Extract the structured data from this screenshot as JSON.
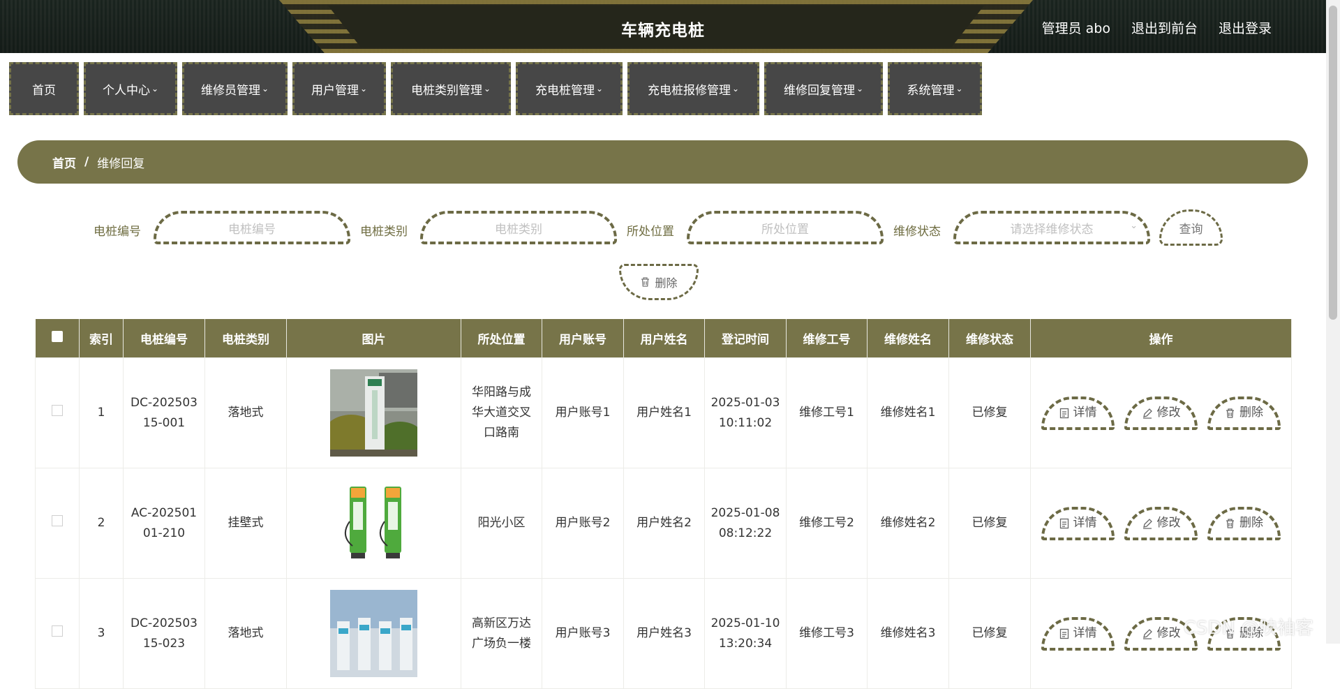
{
  "header": {
    "title": "车辆充电桩",
    "user_label": "管理员 abo",
    "to_front": "退出到前台",
    "logout": "退出登录"
  },
  "nav": [
    {
      "label": "首页",
      "has_dropdown": false
    },
    {
      "label": "个人中心",
      "has_dropdown": true
    },
    {
      "label": "维修员管理",
      "has_dropdown": true
    },
    {
      "label": "用户管理",
      "has_dropdown": true
    },
    {
      "label": "电桩类别管理",
      "has_dropdown": true
    },
    {
      "label": "充电桩管理",
      "has_dropdown": true
    },
    {
      "label": "充电桩报修管理",
      "has_dropdown": true
    },
    {
      "label": "维修回复管理",
      "has_dropdown": true
    },
    {
      "label": "系统管理",
      "has_dropdown": true
    }
  ],
  "breadcrumb": {
    "home": "首页",
    "separator": "/",
    "current": "维修回复"
  },
  "search": {
    "pile_no_label": "电桩编号",
    "pile_no_placeholder": "电桩编号",
    "category_label": "电桩类别",
    "category_placeholder": "电桩类别",
    "location_label": "所处位置",
    "location_placeholder": "所处位置",
    "status_label": "维修状态",
    "status_placeholder": "请选择维修状态",
    "query_button": "查询",
    "delete_button": "删除"
  },
  "table": {
    "columns": [
      "索引",
      "电桩编号",
      "电桩类别",
      "图片",
      "所处位置",
      "用户账号",
      "用户姓名",
      "登记时间",
      "维修工号",
      "维修姓名",
      "维修状态",
      "操作"
    ],
    "rows": [
      {
        "index": "1",
        "pile_no": "DC-20250315-001",
        "category": "落地式",
        "image": "floor-charger-photo",
        "location": "华阳路与成华大道交叉口路南",
        "account": "用户账号1",
        "name": "用户姓名1",
        "time": "2025-01-03 10:11:02",
        "worker_no": "维修工号1",
        "worker_name": "维修姓名1",
        "status": "已修复"
      },
      {
        "index": "2",
        "pile_no": "AC-20250101-210",
        "category": "挂壁式",
        "image": "wall-charger-photo",
        "location": "阳光小区",
        "account": "用户账号2",
        "name": "用户姓名2",
        "time": "2025-01-08 08:12:22",
        "worker_no": "维修工号2",
        "worker_name": "维修姓名2",
        "status": "已修复"
      },
      {
        "index": "3",
        "pile_no": "DC-20250315-023",
        "category": "落地式",
        "image": "station-photo",
        "location": "高新区万达广场负一楼",
        "account": "用户账号3",
        "name": "用户姓名3",
        "time": "2025-01-10 13:20:34",
        "worker_no": "维修工号3",
        "worker_name": "维修姓名3",
        "status": "已修复"
      }
    ],
    "actions": {
      "detail": "详情",
      "edit": "修改",
      "delete": "删除"
    }
  },
  "watermark": "CSDN @映袖客",
  "colors": {
    "accent": "#777449",
    "nav_bg": "#474747",
    "border": "#6c6a45"
  }
}
